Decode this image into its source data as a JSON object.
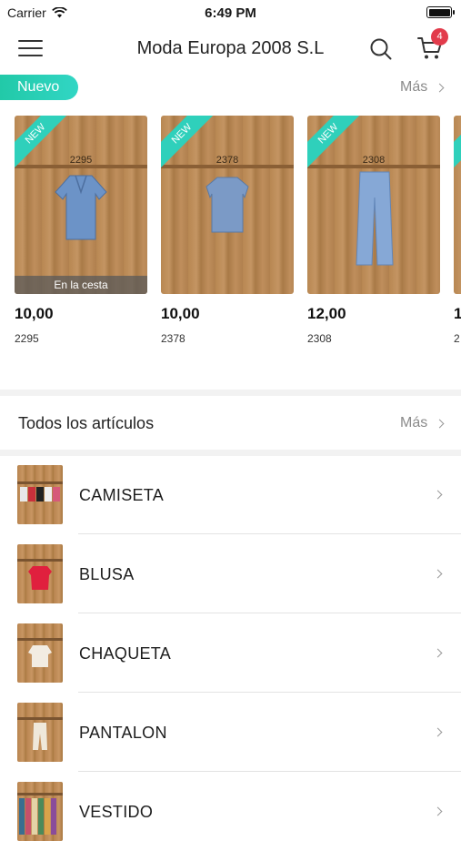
{
  "status_bar": {
    "carrier": "Carrier",
    "time": "6:49 PM"
  },
  "nav": {
    "title": "Moda Europa 2008 S.L",
    "cart_count": "4"
  },
  "nuevo": {
    "label": "Nuevo",
    "more_label": "Más",
    "products": [
      {
        "code": "2295",
        "price": "10,00",
        "sku": "2295",
        "ribbon": "NEW",
        "in_cart_label": "En la cesta",
        "color": "#6c93c7"
      },
      {
        "code": "2378",
        "price": "10,00",
        "sku": "2378",
        "ribbon": "NEW",
        "color": "#7b9ac6"
      },
      {
        "code": "2308",
        "price": "12,00",
        "sku": "2308",
        "ribbon": "NEW",
        "color": "#86a8d6"
      },
      {
        "price": "1",
        "sku": "2"
      }
    ]
  },
  "all_articles": {
    "title": "Todos los artículos",
    "more_label": "Más",
    "categories": [
      {
        "label": "CAMISETA"
      },
      {
        "label": "BLUSA"
      },
      {
        "label": "CHAQUETA"
      },
      {
        "label": "PANTALON"
      },
      {
        "label": "VESTIDO"
      }
    ]
  },
  "colors": {
    "accent": "#2fd0bb",
    "badge": "#e23b4b",
    "price": "#111111"
  }
}
